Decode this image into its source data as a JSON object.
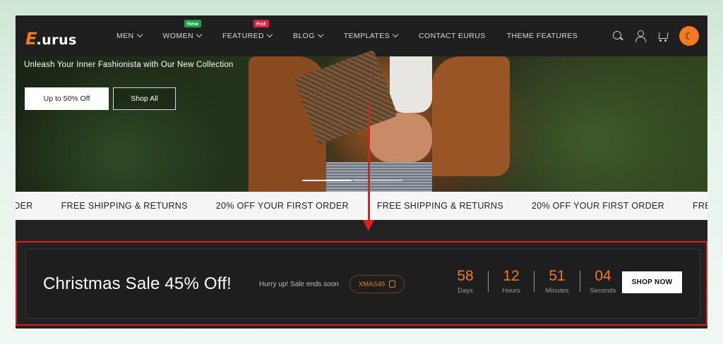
{
  "brand": {
    "logo_e": "E",
    "logo_rest": ".urus"
  },
  "nav": {
    "items": [
      {
        "label": "MEN",
        "badge": ""
      },
      {
        "label": "WOMEN",
        "badge": "New"
      },
      {
        "label": "FEATURED",
        "badge": "Hot"
      },
      {
        "label": "BLOG",
        "badge": ""
      },
      {
        "label": "TEMPLATES",
        "badge": ""
      },
      {
        "label": "CONTACT EURUS",
        "badge": ""
      },
      {
        "label": "THEME FEATURES",
        "badge": ""
      }
    ],
    "icons": [
      "search-icon",
      "user-icon",
      "cart-icon",
      "moon-icon"
    ]
  },
  "hero": {
    "tagline": "Unleash Your Inner Fashionista with Our New Collection",
    "primary_button": "Up to 50% Off",
    "secondary_button": "Shop All"
  },
  "marquee": {
    "items": [
      "RDER",
      "FREE SHIPPING & RETURNS",
      "20% OFF YOUR FIRST ORDER",
      "FREE SHIPPING & RETURNS",
      "20% OFF YOUR FIRST ORDER",
      "FREE SHIPPIN"
    ]
  },
  "sale": {
    "title": "Christmas Sale 45% Off!",
    "subtitle": "Hurry up! Sale ends soon",
    "coupon": "XMAS45",
    "countdown": [
      {
        "value": "58",
        "label": "Days"
      },
      {
        "value": "12",
        "label": "Hours"
      },
      {
        "value": "51",
        "label": "Minutes"
      },
      {
        "value": "04",
        "label": "Seconds"
      }
    ],
    "button": "SHOP NOW"
  },
  "colors": {
    "accent": "#f47920",
    "highlight": "#e01e1e",
    "badge_new": "#1aa24b",
    "badge_hot": "#d7263d"
  }
}
